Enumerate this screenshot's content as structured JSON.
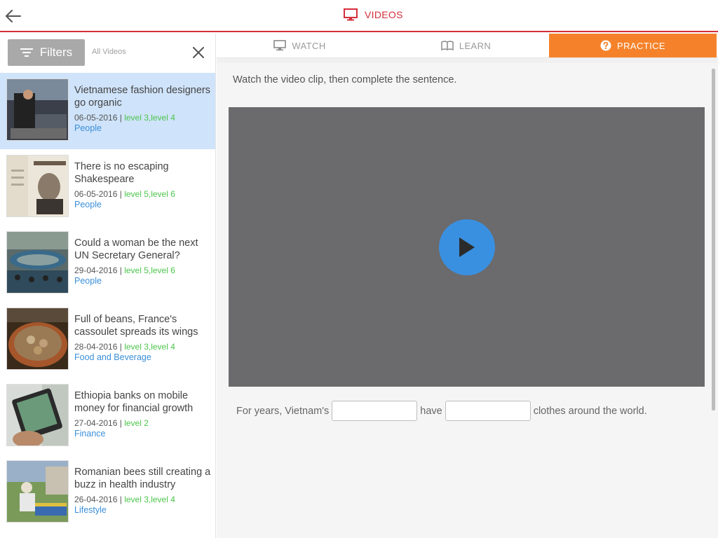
{
  "header": {
    "title": "VIDEOS",
    "back_icon": "arrow-left-icon",
    "title_icon": "monitor-icon",
    "accent": "#d32f3a"
  },
  "sidebar": {
    "filters_label": "Filters",
    "all_videos_label": "All Videos",
    "close_icon": "close-icon",
    "videos": [
      {
        "title": "Vietnamese fashion designers go organic",
        "date": "06-05-2016",
        "levels": "level 3,level 4",
        "category": "People"
      },
      {
        "title": "There is no escaping Shakespeare",
        "date": "06-05-2016",
        "levels": "level 5,level 6",
        "category": "People"
      },
      {
        "title": "Could a woman be the next UN Secretary General?",
        "date": "29-04-2016",
        "levels": "level 5,level 6",
        "category": "People"
      },
      {
        "title": "Full of beans, France's cassoulet spreads its wings",
        "date": "28-04-2016",
        "levels": "level 3,level 4",
        "category": "Food and Beverage"
      },
      {
        "title": "Ethiopia banks on mobile money for financial growth",
        "date": "27-04-2016",
        "levels": "level 2",
        "category": "Finance"
      },
      {
        "title": "Romanian bees still creating a buzz in health industry",
        "date": "26-04-2016",
        "levels": "level 3,level 4",
        "category": "Lifestyle"
      }
    ]
  },
  "tabs": [
    {
      "label": "WATCH",
      "icon": "monitor-icon"
    },
    {
      "label": "LEARN",
      "icon": "book-icon"
    },
    {
      "label": "PRACTICE",
      "icon": "question-icon"
    }
  ],
  "practice": {
    "instruction": "Watch the video clip, then complete the sentence.",
    "sentence_part1": "For years, Vietnam's",
    "sentence_part2": "have",
    "sentence_part3": "clothes around the world.",
    "blank1_value": "",
    "blank2_value": ""
  },
  "colors": {
    "practice_tab": "#f5822a",
    "play_button": "#3a90e0",
    "level_text": "#4cc44c",
    "category_text": "#3a8fd9",
    "selected_row": "#cfe3fa"
  }
}
